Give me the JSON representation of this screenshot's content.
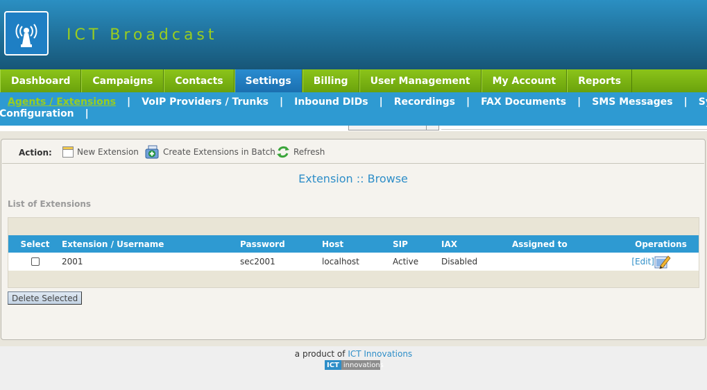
{
  "app": {
    "title": "ICT Broadcast"
  },
  "mainnav": [
    {
      "label": "Dashboard"
    },
    {
      "label": "Campaigns"
    },
    {
      "label": "Contacts"
    },
    {
      "label": "Settings",
      "active": true
    },
    {
      "label": "Billing"
    },
    {
      "label": "User Management"
    },
    {
      "label": "My Account"
    },
    {
      "label": "Reports"
    }
  ],
  "subnav": {
    "items": [
      "Agents / Extensions",
      "VoIP Providers / Trunks",
      "Inbound DIDs",
      "Recordings",
      "FAX Documents",
      "SMS Messages",
      "System",
      "Configuration"
    ],
    "separator": "|"
  },
  "actions": {
    "label": "Action:",
    "new_extension": "New Extension",
    "create_batch": "Create Extensions in Batch",
    "refresh": "Refresh"
  },
  "page": {
    "title": "Extension :: Browse",
    "section_title": "List of Extensions"
  },
  "table": {
    "columns": [
      "Select",
      "Extension / Username",
      "Password",
      "Host",
      "SIP",
      "IAX",
      "Assigned to",
      "Operations"
    ],
    "rows": [
      {
        "extension": "2001",
        "password": "sec2001",
        "host": "localhost",
        "sip": "Active",
        "iax": "Disabled",
        "assigned": "",
        "edit_label": "[Edit]"
      }
    ]
  },
  "delete_selected": "Delete Selected",
  "footer": {
    "prefix": "a product of",
    "company": "ICT Innovations",
    "badge_left": "ICT",
    "badge_right": "innovations"
  },
  "colors": {
    "header_blue": "#1f6f98",
    "nav_green": "#6aa20c",
    "accent_blue": "#2e9ad2",
    "title_green": "#9acd1f"
  }
}
